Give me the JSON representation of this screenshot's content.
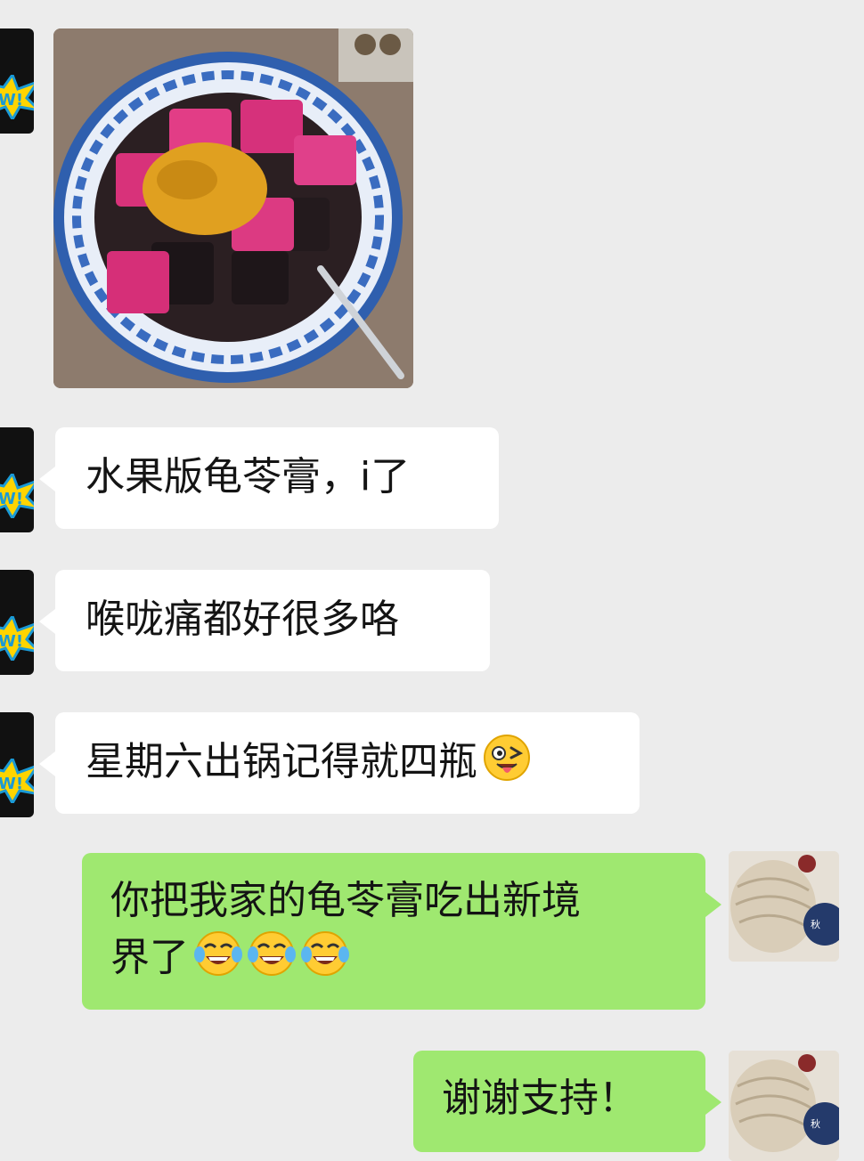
{
  "messages": [
    {
      "sender": "contact",
      "type": "image",
      "content": "photo of fruit guiling jelly (dragon fruit, passion fruit, herbal jelly in blue bowl)"
    },
    {
      "sender": "contact",
      "type": "text",
      "text": "水果版龟苓膏，i了"
    },
    {
      "sender": "contact",
      "type": "text",
      "text": "喉咙痛都好很多咯"
    },
    {
      "sender": "contact",
      "type": "text",
      "text": "星期六出锅记得就四瓶",
      "emoji": "winking-tongue-emoji"
    },
    {
      "sender": "me",
      "type": "text",
      "lines": [
        "你把我家的龟苓膏吃出新境",
        "界了"
      ],
      "emojis": [
        "tears-of-joy-emoji",
        "tears-of-joy-emoji",
        "tears-of-joy-emoji"
      ]
    },
    {
      "sender": "me",
      "type": "text",
      "text": "谢谢支持！"
    }
  ],
  "colors": {
    "background": "#ececec",
    "incoming_bubble": "#ffffff",
    "outgoing_bubble": "#9fe870"
  }
}
